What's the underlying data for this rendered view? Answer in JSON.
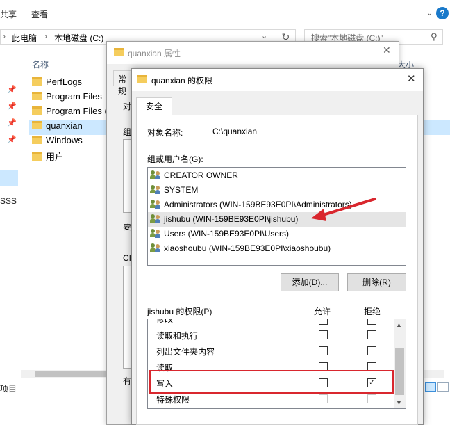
{
  "explorer": {
    "ribbon_tabs": [
      "共享",
      "查看"
    ],
    "address": {
      "root": "此电脑",
      "drive": "本地磁盘 (C:)"
    },
    "search_placeholder": "搜索\"本地磁盘 (C:)\"",
    "columns": {
      "name": "名称",
      "size": "大小"
    },
    "files": [
      "PerfLogs",
      "Program Files",
      "Program Files (",
      "quanxian",
      "Windows",
      "用户"
    ],
    "selected_file": "quanxian",
    "nav_label": "SSS",
    "status": "项目"
  },
  "properties_dialog": {
    "title": "quanxian 属性",
    "tab": "常规",
    "fragments": {
      "row1": "对",
      "row2": "组",
      "row3": "要",
      "row4": "CI",
      "row5": "有"
    }
  },
  "permissions_dialog": {
    "title": "quanxian 的权限",
    "tab": "安全",
    "object_label": "对象名称:",
    "object_value": "C:\\quanxian",
    "group_label": "组或用户名(G):",
    "users": [
      "CREATOR OWNER",
      "SYSTEM",
      "Administrators (WIN-159BE93E0PI\\Administrators)",
      "jishubu (WIN-159BE93E0PI\\jishubu)",
      "Users (WIN-159BE93E0PI\\Users)",
      "xiaoshoubu (WIN-159BE93E0PI\\xiaoshoubu)"
    ],
    "selected_user_index": 3,
    "add_button": "添加(D)...",
    "remove_button": "删除(R)",
    "perm_header": "jishubu 的权限(P)",
    "allow_header": "允许",
    "deny_header": "拒绝",
    "permissions": [
      {
        "label": "修改",
        "allow": false,
        "deny": false
      },
      {
        "label": "读取和执行",
        "allow": false,
        "deny": false
      },
      {
        "label": "列出文件夹内容",
        "allow": false,
        "deny": false
      },
      {
        "label": "读取",
        "allow": false,
        "deny": false
      },
      {
        "label": "写入",
        "allow": false,
        "deny": true
      },
      {
        "label": "特殊权限",
        "allow": false,
        "deny": false
      }
    ],
    "highlighted_permission": "写入"
  },
  "colors": {
    "highlight": "#d9272e",
    "arrow": "#d9272e",
    "selection": "#cce8ff"
  }
}
